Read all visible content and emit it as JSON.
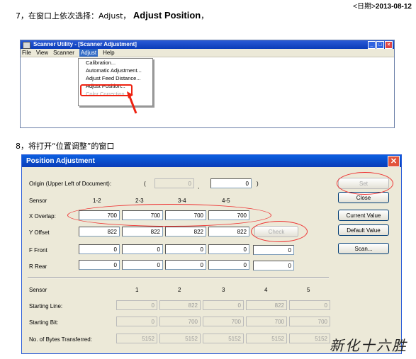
{
  "header": {
    "date_prefix": "<日期>",
    "date": "2013-08-12"
  },
  "step7": {
    "text": "7，在窗口上依次选择：Adjust，",
    "bold": "Adjust Position",
    "suffix": "，"
  },
  "win1": {
    "title": "Scanner Utility - [Scanner Adjustment]",
    "menu": [
      "File",
      "View",
      "Scanner",
      "Adjust",
      "Help"
    ],
    "dropdown": [
      "Calibration...",
      "Automatic Adjustment...",
      "Adjust Feed Distance...",
      "Adjust Position...",
      "Color Correction..."
    ]
  },
  "step8": {
    "text": "8，将打开“位置调整”的窗口"
  },
  "win2": {
    "title": "Position Adjustment",
    "origin_label": "Origin (Upper Left of Document):",
    "origin_x": "0",
    "origin_y": "0",
    "paren_open": "(",
    "comma": ",",
    "paren_close": ")",
    "sensor_label": "Sensor",
    "sensor_pairs": [
      "1-2",
      "2-3",
      "3-4",
      "4-5"
    ],
    "x_overlap_label": "X Overlap:",
    "x_overlap": [
      "700",
      "700",
      "700",
      "700"
    ],
    "y_offset_label": "Y Offset",
    "y_offset": [
      "822",
      "822",
      "822",
      "822"
    ],
    "f_front_label": "F Front",
    "f_front": [
      "0",
      "0",
      "0",
      "0",
      "0"
    ],
    "r_rear_label": "R Rear",
    "r_rear": [
      "0",
      "0",
      "0",
      "0",
      "0"
    ],
    "sensors": [
      "1",
      "2",
      "3",
      "4",
      "5"
    ],
    "starting_line_label": "Starting Line:",
    "starting_line": [
      "0",
      "822",
      "0",
      "822",
      "0"
    ],
    "starting_bit_label": "Starting Bit:",
    "starting_bit": [
      "0",
      "700",
      "700",
      "700",
      "700"
    ],
    "bytes_label": "No. of Bytes Transferred:",
    "bytes": [
      "5152",
      "5152",
      "5152",
      "5152",
      "5152"
    ],
    "buttons": {
      "set": "Set",
      "close": "Close",
      "current": "Current Value",
      "default": "Default Value",
      "scan": "Scan...",
      "check": "Check"
    }
  },
  "signature": "新化十六胜"
}
